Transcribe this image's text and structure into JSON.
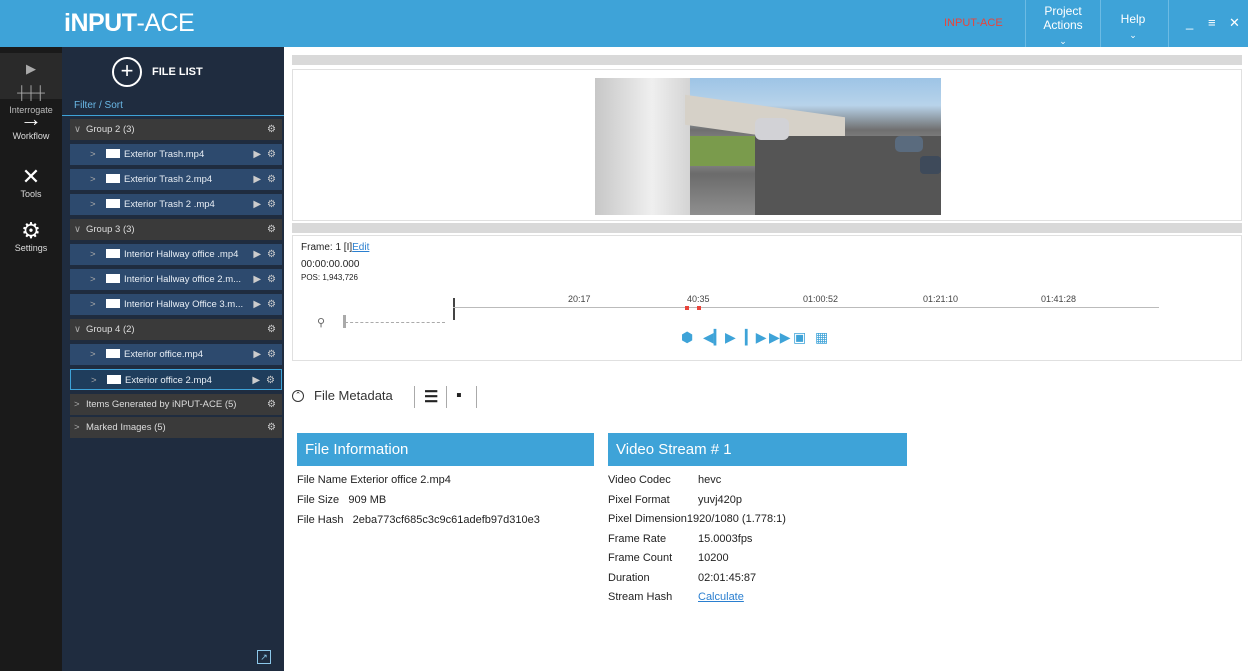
{
  "titlebar": {
    "logo_a": "iNPUT",
    "logo_b": "-ACE",
    "license_text": "INPUT-ACE",
    "menu_project": "Project Actions",
    "menu_help": "Help",
    "minimize": "_",
    "restore": "≡",
    "close": "✕"
  },
  "rail": [
    {
      "label": "Interrogate"
    },
    {
      "label": "Workflow"
    },
    {
      "label": "Tools"
    },
    {
      "label": "Settings"
    }
  ],
  "filelist": {
    "header": "FILE LIST",
    "filter": "Filter / Sort",
    "rows": [
      {
        "type": "group",
        "label": "Group 2 (3)"
      },
      {
        "type": "file",
        "label": "Exterior Trash.mp4"
      },
      {
        "type": "file",
        "label": "Exterior Trash 2.mp4"
      },
      {
        "type": "file",
        "label": "Exterior Trash 2 .mp4"
      },
      {
        "type": "group",
        "label": "Group 3 (3)"
      },
      {
        "type": "file",
        "label": "Interior Hallway office .mp4"
      },
      {
        "type": "file",
        "label": "Interior Hallway office 2.m..."
      },
      {
        "type": "file",
        "label": "Interior Hallway Office 3.m..."
      },
      {
        "type": "group",
        "label": "Group 4 (2)"
      },
      {
        "type": "file",
        "label": "Exterior office.mp4"
      },
      {
        "type": "file",
        "label": "Exterior office 2.mp4",
        "selected": true
      },
      {
        "type": "group",
        "label": "Items Generated by iNPUT-ACE (5)",
        "collapsed": true
      },
      {
        "type": "group",
        "label": "Marked Images (5)",
        "collapsed": true
      }
    ]
  },
  "player": {
    "frame_label": "Frame:",
    "frame_value": "1 [I]",
    "edit": "Edit",
    "time": "00:00:00.000",
    "pos": "POS: 1,943,726",
    "ticks": [
      "20:17",
      "40:35",
      "01:00:52",
      "01:21:10",
      "01:41:28"
    ]
  },
  "metadata": {
    "title": "File Metadata",
    "file_info": {
      "heading": "File Information",
      "rows": [
        {
          "k": "File Name",
          "v": "Exterior office 2.mp4"
        },
        {
          "k": "File Size",
          "v": "909 MB"
        },
        {
          "k": "File Hash",
          "v": "2eba773cf685c3c9c61adefb97d310e3"
        }
      ]
    },
    "video_stream": {
      "heading": "Video Stream # 1",
      "rows": [
        {
          "k": "Video Codec",
          "v": "hevc"
        },
        {
          "k": "Pixel Format",
          "v": "yuvj420p"
        },
        {
          "k": "Pixel Dimension",
          "v": "1920/1080 (1.778:1)"
        },
        {
          "k": "Frame Rate",
          "v": "15.0003fps"
        },
        {
          "k": "Frame Count",
          "v": "10200"
        },
        {
          "k": "Duration",
          "v": "02:01:45:87"
        },
        {
          "k": "Stream Hash",
          "v": "Calculate"
        }
      ]
    }
  },
  "colors": {
    "accent": "#3ea3d8",
    "panel": "#1f2c3f",
    "rail": "#1a1a1a",
    "marker": "#e8443b"
  }
}
